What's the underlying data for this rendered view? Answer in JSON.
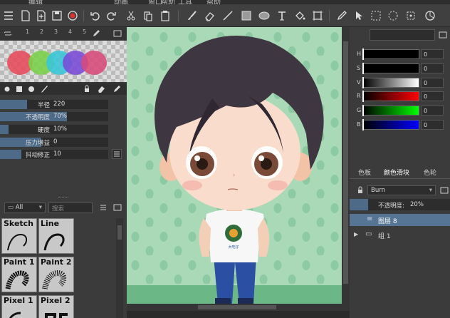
{
  "menubar": {
    "items": [
      "编辑",
      "动画",
      "窗口",
      "帮助",
      "工具",
      "帮助"
    ]
  },
  "toolbar": {
    "icons": [
      "list-icon",
      "new-file-icon",
      "open-file-icon",
      "save-icon",
      "record-icon",
      "undo-icon",
      "redo-icon",
      "cut-icon",
      "paste-icon",
      "clipboard-icon",
      "brush-icon",
      "eraser-icon",
      "line-icon",
      "rectangle-icon",
      "ellipse-icon",
      "text-icon",
      "fill-icon",
      "frame-icon",
      "eyedropper-icon",
      "select-arrow-icon",
      "rect-select-icon",
      "lasso-icon",
      "color-wheel-icon"
    ]
  },
  "left_panel": {
    "tabs": [
      "1",
      "2",
      "3",
      "4",
      "5"
    ],
    "swatches": [
      "#e84a5a",
      "#7ad14a",
      "#38c6d8",
      "#7a4ad8",
      "#d84a7a"
    ],
    "brush_params": [
      {
        "label": "半径",
        "value": "220",
        "fill": 0.25
      },
      {
        "label": "不透明度",
        "value": "70%",
        "fill": 0.62
      },
      {
        "label": "硬度",
        "value": "10%",
        "fill": 0.08
      },
      {
        "label": "压力增益",
        "value": "0",
        "fill": 0.38
      },
      {
        "label": "抖动修正",
        "value": "10",
        "fill": 0.2
      }
    ],
    "library_filter": "All",
    "library_search_placeholder": "搜索",
    "brushes": [
      "Sketch",
      "Line",
      "Paint 1",
      "Paint 2",
      "Pixel 1",
      "Pixel 2"
    ]
  },
  "color_panel": {
    "channels": [
      {
        "key": "H",
        "value": "0"
      },
      {
        "key": "S",
        "value": "0"
      },
      {
        "key": "V",
        "value": "0"
      },
      {
        "key": "R",
        "value": "0"
      },
      {
        "key": "G",
        "value": "0"
      },
      {
        "key": "B",
        "value": "0"
      }
    ],
    "tabs": [
      "色板",
      "颜色滑块",
      "色轮"
    ]
  },
  "layer_panel": {
    "blend_mode": "Burn",
    "opacity_label": "不透明度:",
    "opacity_value": "20%",
    "layers": [
      "图层 8",
      "组 1"
    ]
  }
}
